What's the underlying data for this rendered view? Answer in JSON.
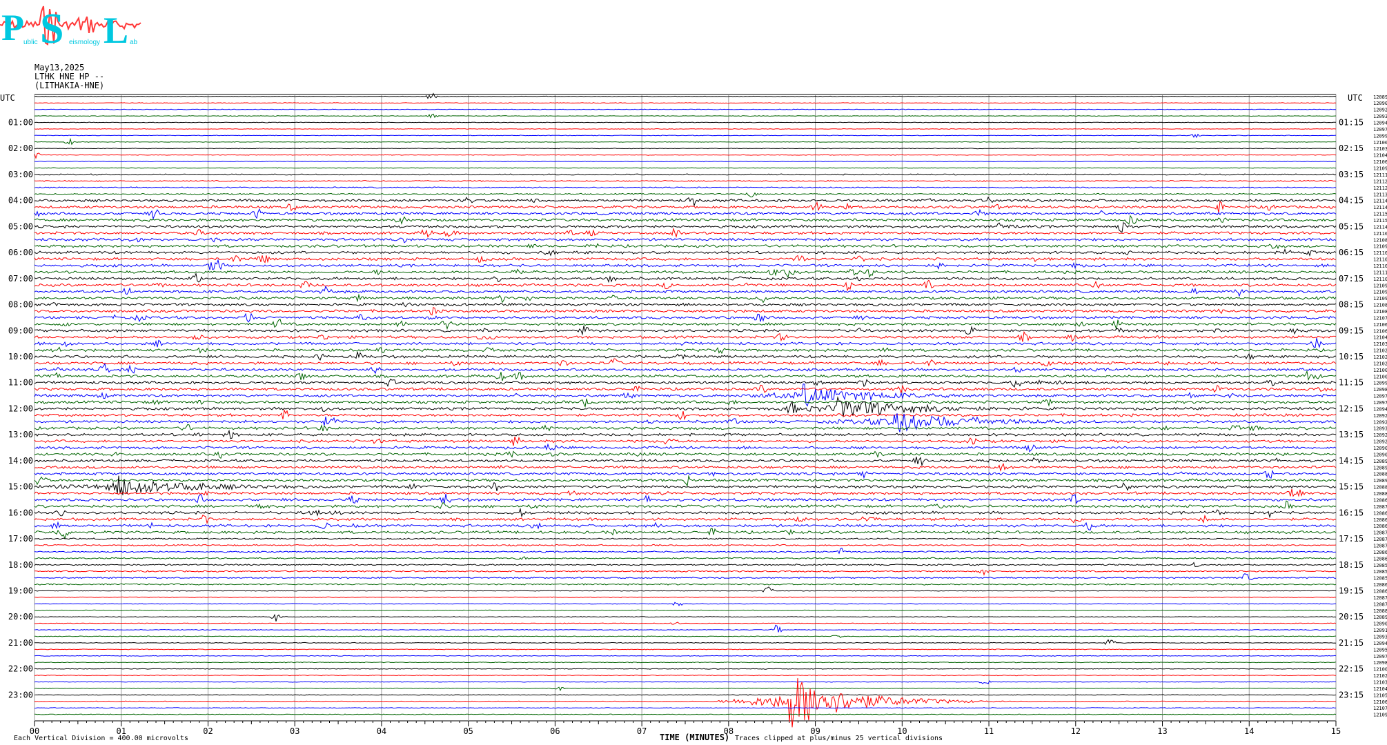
{
  "logo": {
    "letters": [
      "P",
      "S",
      "L"
    ],
    "small_text": [
      "ublic",
      "eismology",
      "ab"
    ],
    "text_color": "#00c8e0",
    "wave_color": "#ff3b3b"
  },
  "header": {
    "date": "May13,2025",
    "station": "LTHK HNE HP --",
    "station_full": "(LITHAKIA-HNE)"
  },
  "chart_data": {
    "type": "line",
    "xlabel": "TIME (MINUTES)",
    "x_ticks": [
      "00",
      "01",
      "02",
      "03",
      "04",
      "05",
      "06",
      "07",
      "08",
      "09",
      "10",
      "11",
      "12",
      "13",
      "14",
      "15"
    ],
    "xlim": [
      0,
      15
    ],
    "left_axis_title": "UTC",
    "right_axis_title": "UTC",
    "left_hour_labels": [
      "01:00",
      "02:00",
      "03:00",
      "04:00",
      "05:00",
      "06:00",
      "07:00",
      "08:00",
      "09:00",
      "10:00",
      "11:00",
      "12:00",
      "13:00",
      "14:00",
      "15:00",
      "16:00",
      "17:00",
      "18:00",
      "19:00",
      "20:00",
      "21:00",
      "22:00",
      "23:00"
    ],
    "right_hour_labels": [
      "01:15",
      "02:15",
      "03:15",
      "04:15",
      "05:15",
      "06:15",
      "07:15",
      "08:15",
      "09:15",
      "10:15",
      "11:15",
      "12:15",
      "13:15",
      "14:15",
      "15:15",
      "16:15",
      "17:15",
      "18:15",
      "19:15",
      "20:15",
      "21:15",
      "22:15",
      "23:15"
    ],
    "trace_color_cycle": [
      "#000000",
      "#ff0000",
      "#0000ff",
      "#006400"
    ],
    "trace_count": 96,
    "trace_baselines": [
      "12089",
      "12090",
      "12092",
      "12093",
      "12094",
      "12097",
      "12099",
      "12100",
      "12103",
      "12104",
      "12106",
      "12109",
      "12111",
      "12112",
      "12112",
      "12113",
      "12114",
      "12114",
      "12115",
      "12115",
      "12114",
      "12110",
      "12108",
      "12109",
      "12110",
      "12110",
      "12110",
      "12111",
      "12110",
      "12109",
      "12109",
      "12109",
      "12108",
      "12108",
      "12107",
      "12106",
      "12106",
      "12104",
      "12103",
      "12102",
      "12102",
      "12102",
      "12100",
      "12100",
      "12099",
      "12098",
      "12097",
      "12097",
      "12094",
      "12092",
      "12092",
      "12093",
      "12092",
      "12092",
      "12090",
      "12090",
      "12089",
      "12089",
      "12088",
      "12089",
      "12088",
      "12088",
      "12086",
      "12087",
      "12086",
      "12086",
      "12086",
      "12087",
      "12087",
      "12087",
      "12086",
      "12086",
      "12085",
      "12085",
      "12085",
      "12086",
      "12086",
      "12087",
      "12087",
      "12088",
      "12089",
      "12090",
      "12091",
      "12093",
      "12094",
      "12095",
      "12097",
      "12098",
      "12100",
      "12102",
      "12103",
      "12104",
      "12105",
      "12106",
      "12107",
      "12109"
    ],
    "events": [
      {
        "trace": 93,
        "minute": 8.7,
        "amplitude": "large",
        "note": "strong shaking"
      },
      {
        "trace": 46,
        "minute": 8.85,
        "amplitude": "medium"
      },
      {
        "trace": 50,
        "minute": 9.9,
        "amplitude": "medium"
      },
      {
        "trace": 48,
        "minute": 9.25,
        "amplitude": "medium"
      },
      {
        "trace": 60,
        "minute": 0.95,
        "amplitude": "medium"
      }
    ],
    "vertical_division_note": "Each Vertical Division = 400.00 microvolts",
    "clip_note": "Traces clipped at plus/minus 25 vertical divisions"
  },
  "colors": {
    "grid": "#9a9a9a",
    "frame": "#000000"
  }
}
